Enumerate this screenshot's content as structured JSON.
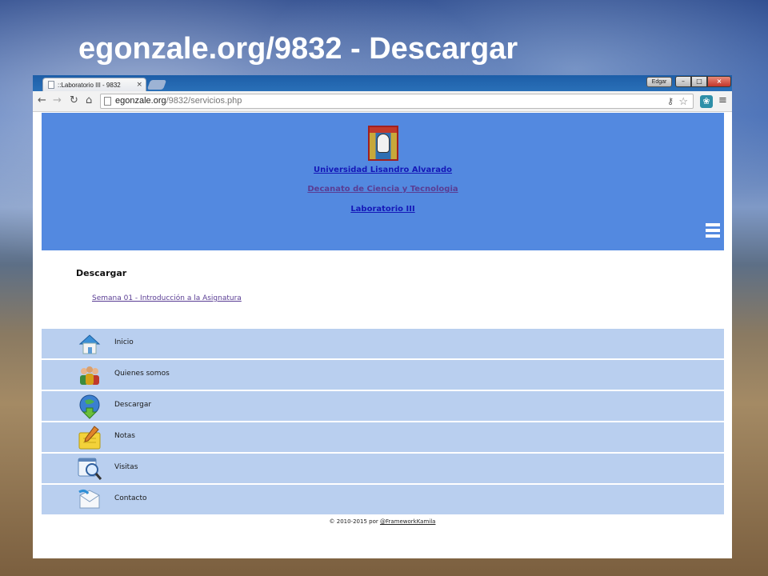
{
  "slide": {
    "title": "egonzale.org/9832 - Descargar"
  },
  "browser": {
    "tab_title": "::Laboratorio III - 9832",
    "tab_close": "×",
    "user_label": "Edgar",
    "win_min": "–",
    "win_max": "□",
    "win_close": "×",
    "url_host": "egonzale.org",
    "url_path": "/9832/servicios.php"
  },
  "header": {
    "link_university": "Universidad Lisandro Alvarado",
    "link_decanato": "Decanato de Ciencia y Tecnologia",
    "link_lab": "Laboratorio III"
  },
  "content": {
    "title": "Descargar",
    "download_link": "Semana 01 - Introducción a la Asignatura"
  },
  "menu": {
    "items": [
      {
        "label": "Inicio"
      },
      {
        "label": "Quienes somos"
      },
      {
        "label": "Descargar"
      },
      {
        "label": "Notas"
      },
      {
        "label": "Visitas"
      },
      {
        "label": "Contacto"
      }
    ]
  },
  "footer": {
    "copyright": "© 2010-2015 por",
    "author_link": "@FrameworkKamila"
  }
}
